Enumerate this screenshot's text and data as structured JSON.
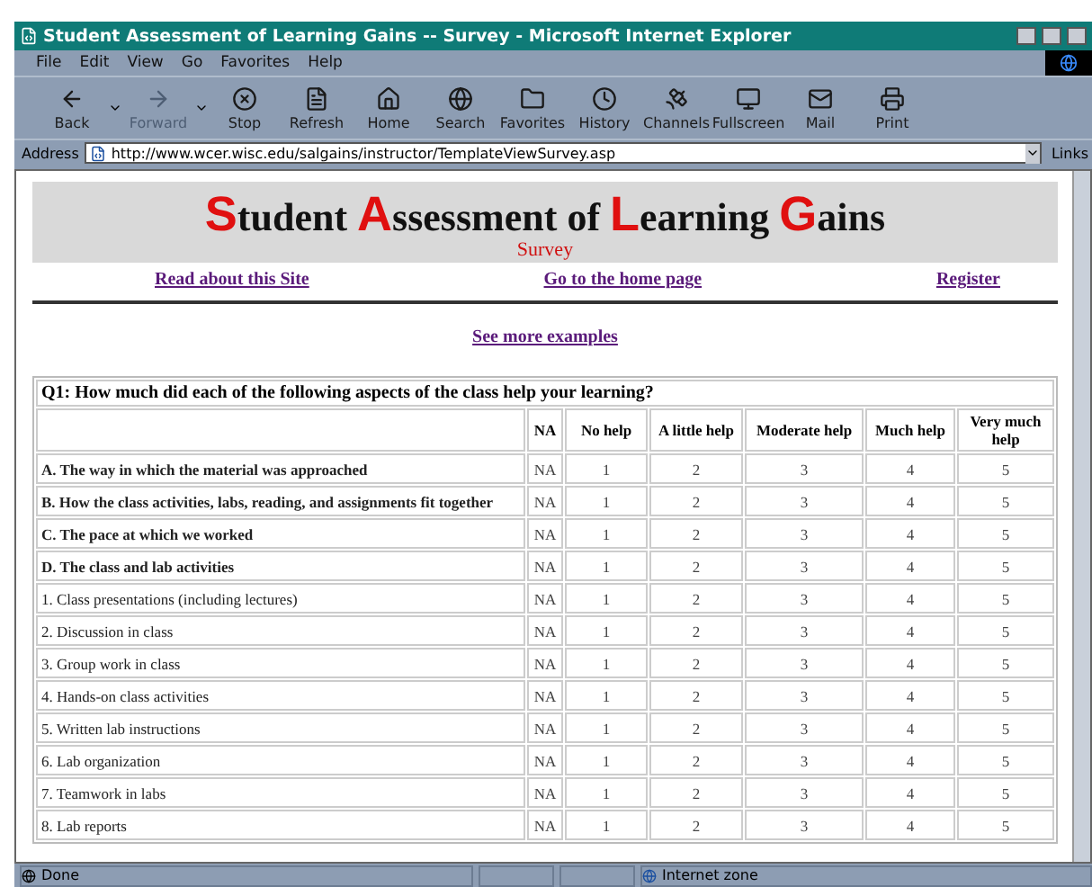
{
  "window": {
    "title": "Student Assessment of Learning Gains -- Survey - Microsoft Internet Explorer"
  },
  "menu": [
    "File",
    "Edit",
    "View",
    "Go",
    "Favorites",
    "Help"
  ],
  "toolbar": [
    {
      "label": "Back",
      "disabled": false,
      "dropdown": true
    },
    {
      "label": "Forward",
      "disabled": true,
      "dropdown": true
    },
    {
      "label": "Stop",
      "disabled": false,
      "dropdown": false
    },
    {
      "label": "Refresh",
      "disabled": false,
      "dropdown": false
    },
    {
      "label": "Home",
      "disabled": false,
      "dropdown": false
    },
    {
      "label": "Search",
      "disabled": false,
      "dropdown": false
    },
    {
      "label": "Favorites",
      "disabled": false,
      "dropdown": false
    },
    {
      "label": "History",
      "disabled": false,
      "dropdown": false
    },
    {
      "label": "Channels",
      "disabled": false,
      "dropdown": false
    },
    {
      "label": "Fullscreen",
      "disabled": false,
      "dropdown": false
    },
    {
      "label": "Mail",
      "disabled": false,
      "dropdown": false
    },
    {
      "label": "Print",
      "disabled": false,
      "dropdown": false
    }
  ],
  "address": {
    "label": "Address",
    "url": "http://www.wcer.wisc.edu/salgains/instructor/TemplateViewSurvey.asp",
    "links": "Links"
  },
  "banner": {
    "title": [
      {
        "kind": "initial",
        "text": "S"
      },
      {
        "kind": "plain",
        "text": "tudent "
      },
      {
        "kind": "initial",
        "text": "A"
      },
      {
        "kind": "plain",
        "text": "ssessment of "
      },
      {
        "kind": "initial",
        "text": "L"
      },
      {
        "kind": "plain",
        "text": "earning "
      },
      {
        "kind": "initial",
        "text": "G"
      },
      {
        "kind": "plain",
        "text": "ains"
      }
    ],
    "subtitle": "Survey"
  },
  "nav_links": [
    "Read about this Site",
    "Go to the home page",
    "Register"
  ],
  "more_link": "See more examples",
  "table": {
    "question": "Q1: How much did each of the following aspects of the class help your learning?",
    "columns": [
      "NA",
      "No help",
      "A little help",
      "Moderate help",
      "Much help",
      "Very much help"
    ],
    "rows": [
      {
        "kind": "section",
        "label": "A. The way in which the material was approached",
        "cells": [
          "NA",
          "1",
          "2",
          "3",
          "4",
          "5"
        ]
      },
      {
        "kind": "section",
        "label": "B. How the class activities, labs, reading, and assignments fit together",
        "cells": [
          "NA",
          "1",
          "2",
          "3",
          "4",
          "5"
        ]
      },
      {
        "kind": "section",
        "label": "C. The pace at which we worked",
        "cells": [
          "NA",
          "1",
          "2",
          "3",
          "4",
          "5"
        ]
      },
      {
        "kind": "section",
        "label": "D. The class and lab activities",
        "cells": [
          "NA",
          "1",
          "2",
          "3",
          "4",
          "5"
        ]
      },
      {
        "kind": "item",
        "label": "1. Class presentations (including lectures)",
        "cells": [
          "NA",
          "1",
          "2",
          "3",
          "4",
          "5"
        ]
      },
      {
        "kind": "item",
        "label": "2. Discussion in class",
        "cells": [
          "NA",
          "1",
          "2",
          "3",
          "4",
          "5"
        ]
      },
      {
        "kind": "item",
        "label": "3. Group work in class",
        "cells": [
          "NA",
          "1",
          "2",
          "3",
          "4",
          "5"
        ]
      },
      {
        "kind": "item",
        "label": "4. Hands-on class activities",
        "cells": [
          "NA",
          "1",
          "2",
          "3",
          "4",
          "5"
        ]
      },
      {
        "kind": "item",
        "label": "5. Written lab instructions",
        "cells": [
          "NA",
          "1",
          "2",
          "3",
          "4",
          "5"
        ]
      },
      {
        "kind": "item",
        "label": "6. Lab organization",
        "cells": [
          "NA",
          "1",
          "2",
          "3",
          "4",
          "5"
        ]
      },
      {
        "kind": "item",
        "label": "7. Teamwork in labs",
        "cells": [
          "NA",
          "1",
          "2",
          "3",
          "4",
          "5"
        ]
      },
      {
        "kind": "item",
        "label": "8. Lab reports",
        "cells": [
          "NA",
          "1",
          "2",
          "3",
          "4",
          "5"
        ]
      }
    ]
  },
  "status_bar": {
    "text": "Done",
    "zone": "Internet zone"
  }
}
